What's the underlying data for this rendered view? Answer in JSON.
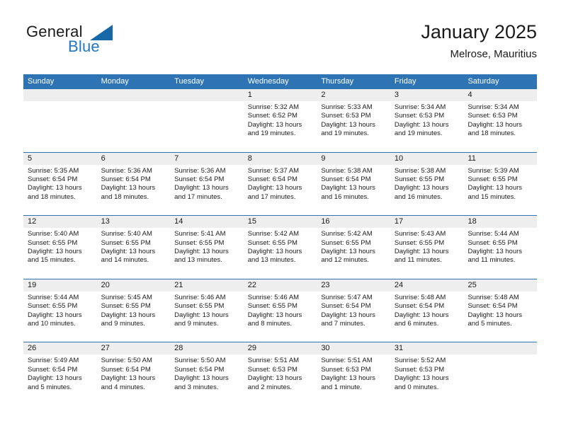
{
  "brand": {
    "name_part1": "General",
    "name_part2": "Blue",
    "triangle_color": "#1668a8",
    "blue_text_color": "#2077c4"
  },
  "header": {
    "title": "January 2025",
    "subtitle": "Melrose, Mauritius"
  },
  "theme": {
    "header_blue": "#2e74b5",
    "day_band_gray": "#eeeeee",
    "text_color": "#1b1b1b"
  },
  "weekdays": [
    "Sunday",
    "Monday",
    "Tuesday",
    "Wednesday",
    "Thursday",
    "Friday",
    "Saturday"
  ],
  "weeks": [
    [
      {
        "day": "",
        "sunrise": "",
        "sunset": "",
        "daylight_line1": "",
        "daylight_line2": ""
      },
      {
        "day": "",
        "sunrise": "",
        "sunset": "",
        "daylight_line1": "",
        "daylight_line2": ""
      },
      {
        "day": "",
        "sunrise": "",
        "sunset": "",
        "daylight_line1": "",
        "daylight_line2": ""
      },
      {
        "day": "1",
        "sunrise": "Sunrise: 5:32 AM",
        "sunset": "Sunset: 6:52 PM",
        "daylight_line1": "Daylight: 13 hours",
        "daylight_line2": "and 19 minutes."
      },
      {
        "day": "2",
        "sunrise": "Sunrise: 5:33 AM",
        "sunset": "Sunset: 6:53 PM",
        "daylight_line1": "Daylight: 13 hours",
        "daylight_line2": "and 19 minutes."
      },
      {
        "day": "3",
        "sunrise": "Sunrise: 5:34 AM",
        "sunset": "Sunset: 6:53 PM",
        "daylight_line1": "Daylight: 13 hours",
        "daylight_line2": "and 19 minutes."
      },
      {
        "day": "4",
        "sunrise": "Sunrise: 5:34 AM",
        "sunset": "Sunset: 6:53 PM",
        "daylight_line1": "Daylight: 13 hours",
        "daylight_line2": "and 18 minutes."
      }
    ],
    [
      {
        "day": "5",
        "sunrise": "Sunrise: 5:35 AM",
        "sunset": "Sunset: 6:54 PM",
        "daylight_line1": "Daylight: 13 hours",
        "daylight_line2": "and 18 minutes."
      },
      {
        "day": "6",
        "sunrise": "Sunrise: 5:36 AM",
        "sunset": "Sunset: 6:54 PM",
        "daylight_line1": "Daylight: 13 hours",
        "daylight_line2": "and 18 minutes."
      },
      {
        "day": "7",
        "sunrise": "Sunrise: 5:36 AM",
        "sunset": "Sunset: 6:54 PM",
        "daylight_line1": "Daylight: 13 hours",
        "daylight_line2": "and 17 minutes."
      },
      {
        "day": "8",
        "sunrise": "Sunrise: 5:37 AM",
        "sunset": "Sunset: 6:54 PM",
        "daylight_line1": "Daylight: 13 hours",
        "daylight_line2": "and 17 minutes."
      },
      {
        "day": "9",
        "sunrise": "Sunrise: 5:38 AM",
        "sunset": "Sunset: 6:54 PM",
        "daylight_line1": "Daylight: 13 hours",
        "daylight_line2": "and 16 minutes."
      },
      {
        "day": "10",
        "sunrise": "Sunrise: 5:38 AM",
        "sunset": "Sunset: 6:55 PM",
        "daylight_line1": "Daylight: 13 hours",
        "daylight_line2": "and 16 minutes."
      },
      {
        "day": "11",
        "sunrise": "Sunrise: 5:39 AM",
        "sunset": "Sunset: 6:55 PM",
        "daylight_line1": "Daylight: 13 hours",
        "daylight_line2": "and 15 minutes."
      }
    ],
    [
      {
        "day": "12",
        "sunrise": "Sunrise: 5:40 AM",
        "sunset": "Sunset: 6:55 PM",
        "daylight_line1": "Daylight: 13 hours",
        "daylight_line2": "and 15 minutes."
      },
      {
        "day": "13",
        "sunrise": "Sunrise: 5:40 AM",
        "sunset": "Sunset: 6:55 PM",
        "daylight_line1": "Daylight: 13 hours",
        "daylight_line2": "and 14 minutes."
      },
      {
        "day": "14",
        "sunrise": "Sunrise: 5:41 AM",
        "sunset": "Sunset: 6:55 PM",
        "daylight_line1": "Daylight: 13 hours",
        "daylight_line2": "and 13 minutes."
      },
      {
        "day": "15",
        "sunrise": "Sunrise: 5:42 AM",
        "sunset": "Sunset: 6:55 PM",
        "daylight_line1": "Daylight: 13 hours",
        "daylight_line2": "and 13 minutes."
      },
      {
        "day": "16",
        "sunrise": "Sunrise: 5:42 AM",
        "sunset": "Sunset: 6:55 PM",
        "daylight_line1": "Daylight: 13 hours",
        "daylight_line2": "and 12 minutes."
      },
      {
        "day": "17",
        "sunrise": "Sunrise: 5:43 AM",
        "sunset": "Sunset: 6:55 PM",
        "daylight_line1": "Daylight: 13 hours",
        "daylight_line2": "and 11 minutes."
      },
      {
        "day": "18",
        "sunrise": "Sunrise: 5:44 AM",
        "sunset": "Sunset: 6:55 PM",
        "daylight_line1": "Daylight: 13 hours",
        "daylight_line2": "and 11 minutes."
      }
    ],
    [
      {
        "day": "19",
        "sunrise": "Sunrise: 5:44 AM",
        "sunset": "Sunset: 6:55 PM",
        "daylight_line1": "Daylight: 13 hours",
        "daylight_line2": "and 10 minutes."
      },
      {
        "day": "20",
        "sunrise": "Sunrise: 5:45 AM",
        "sunset": "Sunset: 6:55 PM",
        "daylight_line1": "Daylight: 13 hours",
        "daylight_line2": "and 9 minutes."
      },
      {
        "day": "21",
        "sunrise": "Sunrise: 5:46 AM",
        "sunset": "Sunset: 6:55 PM",
        "daylight_line1": "Daylight: 13 hours",
        "daylight_line2": "and 9 minutes."
      },
      {
        "day": "22",
        "sunrise": "Sunrise: 5:46 AM",
        "sunset": "Sunset: 6:55 PM",
        "daylight_line1": "Daylight: 13 hours",
        "daylight_line2": "and 8 minutes."
      },
      {
        "day": "23",
        "sunrise": "Sunrise: 5:47 AM",
        "sunset": "Sunset: 6:54 PM",
        "daylight_line1": "Daylight: 13 hours",
        "daylight_line2": "and 7 minutes."
      },
      {
        "day": "24",
        "sunrise": "Sunrise: 5:48 AM",
        "sunset": "Sunset: 6:54 PM",
        "daylight_line1": "Daylight: 13 hours",
        "daylight_line2": "and 6 minutes."
      },
      {
        "day": "25",
        "sunrise": "Sunrise: 5:48 AM",
        "sunset": "Sunset: 6:54 PM",
        "daylight_line1": "Daylight: 13 hours",
        "daylight_line2": "and 5 minutes."
      }
    ],
    [
      {
        "day": "26",
        "sunrise": "Sunrise: 5:49 AM",
        "sunset": "Sunset: 6:54 PM",
        "daylight_line1": "Daylight: 13 hours",
        "daylight_line2": "and 5 minutes."
      },
      {
        "day": "27",
        "sunrise": "Sunrise: 5:50 AM",
        "sunset": "Sunset: 6:54 PM",
        "daylight_line1": "Daylight: 13 hours",
        "daylight_line2": "and 4 minutes."
      },
      {
        "day": "28",
        "sunrise": "Sunrise: 5:50 AM",
        "sunset": "Sunset: 6:54 PM",
        "daylight_line1": "Daylight: 13 hours",
        "daylight_line2": "and 3 minutes."
      },
      {
        "day": "29",
        "sunrise": "Sunrise: 5:51 AM",
        "sunset": "Sunset: 6:53 PM",
        "daylight_line1": "Daylight: 13 hours",
        "daylight_line2": "and 2 minutes."
      },
      {
        "day": "30",
        "sunrise": "Sunrise: 5:51 AM",
        "sunset": "Sunset: 6:53 PM",
        "daylight_line1": "Daylight: 13 hours",
        "daylight_line2": "and 1 minute."
      },
      {
        "day": "31",
        "sunrise": "Sunrise: 5:52 AM",
        "sunset": "Sunset: 6:53 PM",
        "daylight_line1": "Daylight: 13 hours",
        "daylight_line2": "and 0 minutes."
      },
      {
        "day": "",
        "sunrise": "",
        "sunset": "",
        "daylight_line1": "",
        "daylight_line2": ""
      }
    ]
  ]
}
